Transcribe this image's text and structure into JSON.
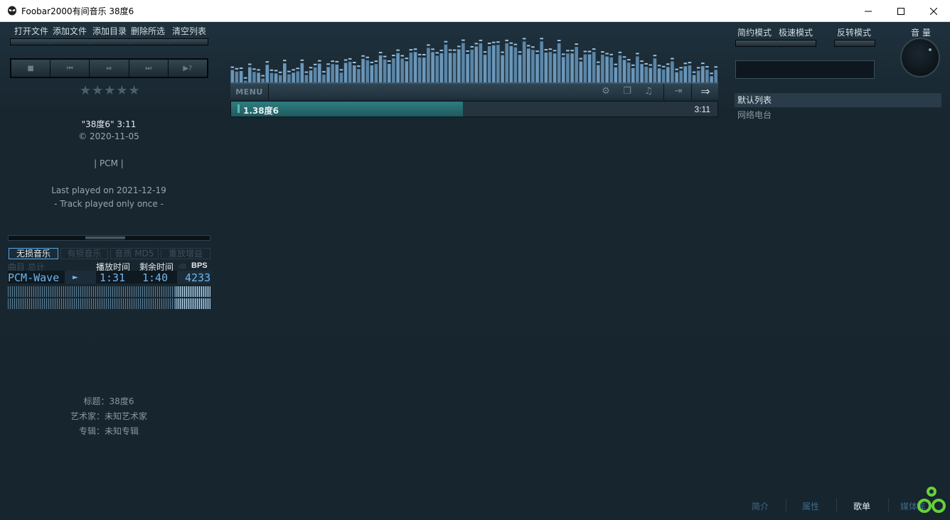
{
  "window": {
    "title": "Foobar2000有间音乐   38度6",
    "icon": "alien-head-icon"
  },
  "toolbar_left": {
    "items": [
      "打开文件",
      "添加文件",
      "添加目录",
      "删除所选",
      "清空列表"
    ]
  },
  "transport": {
    "stop": "■",
    "prev": "⏮",
    "play_pause": "⏯",
    "next": "⏭",
    "random": "▶?"
  },
  "rating": "★★★★★",
  "track_info": {
    "title_line": "\"38度6\" 3:11",
    "date_line": "© 2020-11-05",
    "codec_line": "| PCM |",
    "last_played": "Last played on 2021-12-19",
    "play_count": "- Track played only once -"
  },
  "tabs": {
    "active": "无损音乐",
    "items": [
      "有损音乐",
      "音质 MD5",
      "重放增益"
    ]
  },
  "under_tabs_text": "曲目  总计",
  "columns": {
    "play_time": "播放时间",
    "remain_time": "剩余时间",
    "db": "dB",
    "bps": "BPS"
  },
  "readout": {
    "format": "PCM-Wave",
    "state": "►",
    "elapsed": "1:31",
    "remaining": "1:40",
    "bitrate": "4233"
  },
  "meta": {
    "title": "标题：38度6",
    "artist": "艺术家：未知艺术家",
    "album": "专辑：未知专辑"
  },
  "center": {
    "menu_label": "MENU",
    "now_playing_title": "1.38度6",
    "now_playing_time": "3:11",
    "progress": 0.476,
    "toolbar_icons": [
      "gear-icon",
      "window-icon",
      "music-note-icon",
      "login-icon",
      "arrow-right-icon"
    ]
  },
  "toolbar_right": {
    "simple_mode": "简约模式",
    "fast_mode": "极速模式",
    "invert_mode": "反转模式",
    "volume_label": "音 量"
  },
  "playlists": [
    "默认列表",
    "网络电台"
  ],
  "bottom_tabs": [
    "简介",
    "属性",
    "歌单",
    "媒体库"
  ],
  "bottom_tab_active": "歌单",
  "colors": {
    "accent": "#5aa9e6",
    "progress": "#2e7d80",
    "background": "#17252f"
  }
}
